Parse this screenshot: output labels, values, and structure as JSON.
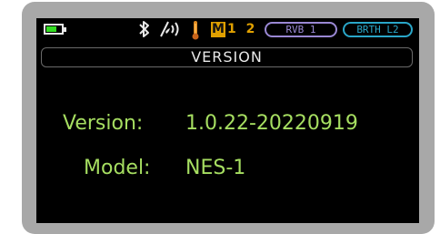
{
  "status_bar": {
    "battery": {
      "icon": "battery-icon",
      "level": 0.7,
      "color": "#33dd22"
    },
    "bluetooth_icon": "bluetooth-icon",
    "signal_icon": "wireless-wave-icon",
    "temperature_icon": "thermometer-icon",
    "memory": {
      "badge": "M",
      "numbers": "1 2",
      "color": "#e0a000"
    },
    "rvb_badge": {
      "label": "RVB 1",
      "color": "#9a88d4"
    },
    "brth_badge": {
      "label": "BRTH L2",
      "color": "#2aa7c9"
    }
  },
  "title": "VERSION",
  "info": {
    "version_label": "Version:",
    "version_value": "1.0.22-20220919",
    "model_label": "Model:",
    "model_value": "NES-1"
  },
  "colors": {
    "screen_background": "#000000",
    "bezel": "#a8a8a8",
    "info_text": "#a6de61",
    "title_text": "#e8e8e8"
  }
}
